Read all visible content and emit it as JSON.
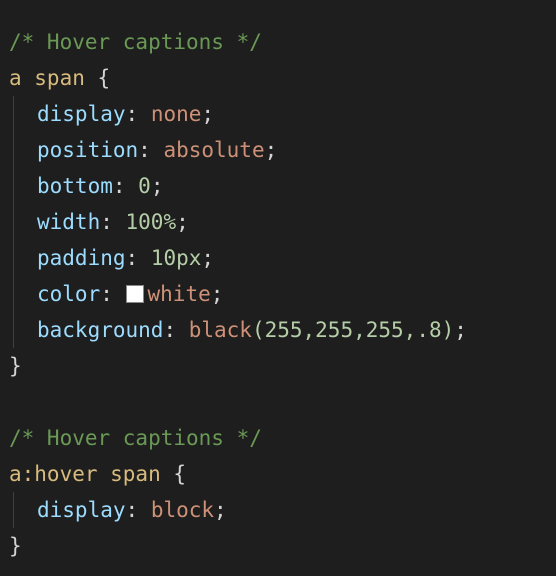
{
  "code": {
    "block1": {
      "comment": "/* Hover captions */",
      "selector": "a span",
      "open_brace": " {",
      "decls": [
        {
          "prop": "display",
          "value": "none"
        },
        {
          "prop": "position",
          "value": "absolute"
        },
        {
          "prop": "bottom",
          "value": "0"
        },
        {
          "prop": "width",
          "value": "100%"
        },
        {
          "prop": "padding",
          "value": "10px"
        },
        {
          "prop": "color",
          "value": "white",
          "swatch_color": "#ffffff"
        },
        {
          "prop": "background",
          "value_fn": "black",
          "value_args": "(255,255,255,.8)"
        }
      ],
      "close_brace": "}"
    },
    "block2": {
      "comment": "/* Hover captions */",
      "selector": "a:hover span",
      "open_brace": " {",
      "decls": [
        {
          "prop": "display",
          "value": "block"
        }
      ],
      "close_brace": "}"
    }
  },
  "colors": {
    "background": "#1e1e1e",
    "comment": "#6a9955",
    "selector": "#d7ba7d",
    "property": "#9cdcfe",
    "string_value": "#ce9178",
    "number_value": "#b5cea8",
    "punctuation": "#d4d4d4"
  }
}
